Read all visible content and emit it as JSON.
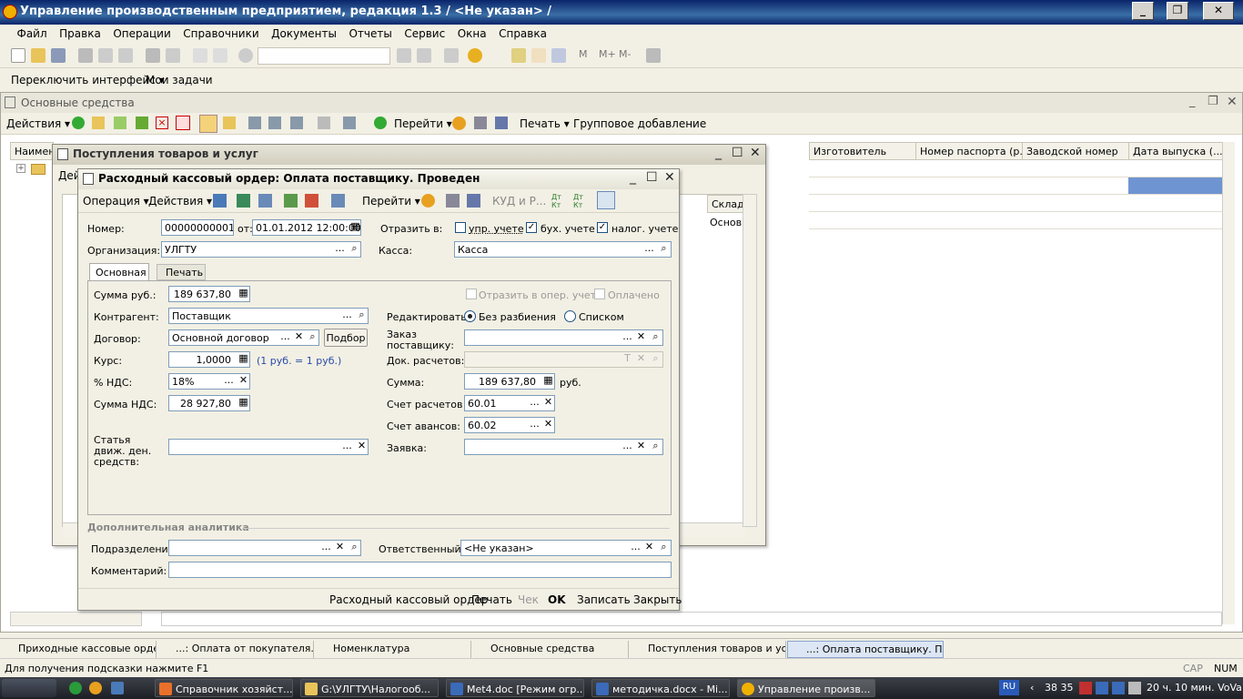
{
  "app": {
    "title": "Управление производственным предприятием, редакция 1.3 / <Не указан> /"
  },
  "menu": [
    "Файл",
    "Правка",
    "Операции",
    "Справочники",
    "Документы",
    "Отчеты",
    "Сервис",
    "Окна",
    "Справка"
  ],
  "toolbar2": {
    "switch_interface": "Переключить интерфейс ▾",
    "my_tasks": "Мои задачи"
  },
  "list_window": {
    "title": "Основные средства",
    "actions": "Действия ▾",
    "goto": "Перейти ▾",
    "print": "Печать ▾",
    "group_add": "Групповое добавление",
    "columns": [
      "Наимен",
      "Изготовитель",
      "Номер паспорта (р...",
      "Заводской номер",
      "Дата выпуска (..."
    ]
  },
  "receipts_window": {
    "title": "Поступления товаров и услуг",
    "actions_short": "Дей",
    "col_warehouse": "Склад",
    "cell_warehouse": "Основн"
  },
  "order": {
    "title": "Расходный кассовый ордер: Оплата поставщику. Проведен",
    "toolbar": {
      "operation": "Операция ▾",
      "actions": "Действия ▾",
      "goto": "Перейти ▾",
      "kud": "КУД и Р..."
    },
    "number_label": "Номер:",
    "number": "00000000001",
    "from_label": "от:",
    "date": "01.01.2012 12:00:00",
    "reflect_label": "Отразить в:",
    "upr_label": "упр. учете",
    "buh_label": "бух. учете",
    "nalog_label": "налог. учете",
    "org_label": "Организация:",
    "org": "УЛГТУ",
    "kassa_label": "Касса:",
    "kassa": "Касса",
    "tabs": [
      "Основная",
      "Печать"
    ],
    "sum_rub_label": "Сумма руб.:",
    "sum_rub": "189 637,80",
    "oper_label": "Отразить в опер. учете",
    "paid_label": "Оплачено",
    "contractor_label": "Контрагент:",
    "contractor": "Поставщик",
    "edit_label": "Редактировать:",
    "radio_nosplit": "Без разбиения",
    "radio_list": "Списком",
    "contract_label": "Договор:",
    "contract": "Основной договор",
    "pick_button": "Подбор",
    "order_label": "Заказ поставщику:",
    "rate_label": "Курс:",
    "rate": "1,0000",
    "rate_note": "(1 руб. = 1 руб.)",
    "doc_calc_label": "Док. расчетов:",
    "vat_pct_label": "% НДС:",
    "vat_pct": "18%",
    "sum_label": "Сумма:",
    "sum": "189 637,80",
    "currency": "руб.",
    "vat_sum_label": "Сумма НДС:",
    "vat_sum": "28 927,80",
    "calc_account_label": "Счет расчетов :",
    "calc_account": "60.01",
    "adv_account_label": "Счет авансов:",
    "adv_account": "60.02",
    "cashflow_label": "Статья движ. ден. средств:",
    "request_label": "Заявка:",
    "extra_section": "Дополнительная аналитика",
    "division_label": "Подразделение:",
    "responsible_label": "Ответственный:",
    "responsible": "<Не указан>",
    "comment_label": "Комментарий:",
    "bottom": {
      "print_form": "Расходный кассовый ордер",
      "print": "Печать",
      "check": "Чек",
      "ok": "OK",
      "save": "Записать",
      "close": "Закрыть"
    }
  },
  "window_tabs": [
    "Приходные кассовые ордера",
    "...: Оплата от покупателя. П...",
    "Номенклатура",
    "Основные средства",
    "Поступления товаров и услуг",
    "...: Оплата поставщику. Пр..."
  ],
  "status": {
    "hint": "Для получения подсказки нажмите F1",
    "cap": "CAP",
    "num": "NUM"
  },
  "taskbar": {
    "items": [
      "Справочник хозяйст...",
      "G:\\УЛГТУ\\Налогооб...",
      "Met4.doc [Режим огр...",
      "методичка.docx - Mi...",
      "Управление произв..."
    ],
    "lang": "RU",
    "num": "38 35",
    "clock": "20 ч. 10 мин. VoVa"
  },
  "colors": {
    "title_blue": "#0a246a",
    "selected_cell": "#6f94d2",
    "accent_blue": "#1c5180"
  }
}
